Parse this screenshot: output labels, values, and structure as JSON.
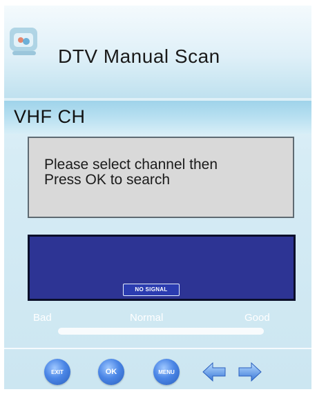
{
  "header": {
    "title": "DTV Manual Scan"
  },
  "band": {
    "label": "VHF CH"
  },
  "message": {
    "lines": [
      "Please select channel then",
      "Press OK to search"
    ]
  },
  "preview": {
    "status_badge": "NO SIGNAL"
  },
  "signal_quality": {
    "labels": {
      "bad": "Bad",
      "normal": "Normal",
      "good": "Good"
    }
  },
  "controls": {
    "exit_label": "EXIT",
    "ok_label": "OK",
    "menu_label": "MENU",
    "left_icon": "arrow-left-icon",
    "right_icon": "arrow-right-icon"
  },
  "colors": {
    "preview_bg": "#2d3494",
    "button_blue": "#4b86e6",
    "message_bg": "#d9d9d9"
  }
}
